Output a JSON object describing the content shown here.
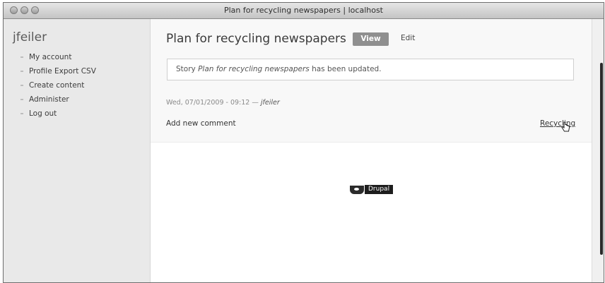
{
  "window": {
    "title": "Plan for recycling newspapers | localhost"
  },
  "sidebar": {
    "username": "jfeiler",
    "items": [
      {
        "label": "My account"
      },
      {
        "label": "Profile Export CSV"
      },
      {
        "label": "Create content"
      },
      {
        "label": "Administer"
      },
      {
        "label": "Log out"
      }
    ]
  },
  "main": {
    "title": "Plan for recycling newspapers",
    "tabs": [
      {
        "label": "View",
        "active": true
      },
      {
        "label": "Edit",
        "active": false
      }
    ],
    "status_message": {
      "prefix": "Story ",
      "title": "Plan for recycling newspapers",
      "suffix": " has been updated."
    },
    "submitted": {
      "date": "Wed, 07/01/2009 - 09:12 — ",
      "author": "jfeiler"
    },
    "add_comment_label": "Add new comment",
    "taxonomy_link": "Recycling"
  },
  "footer": {
    "powered_by": "Drupal"
  },
  "colors": {
    "sidebar_bg": "#e9e9e9",
    "active_tab_bg": "#8f8f8f"
  }
}
